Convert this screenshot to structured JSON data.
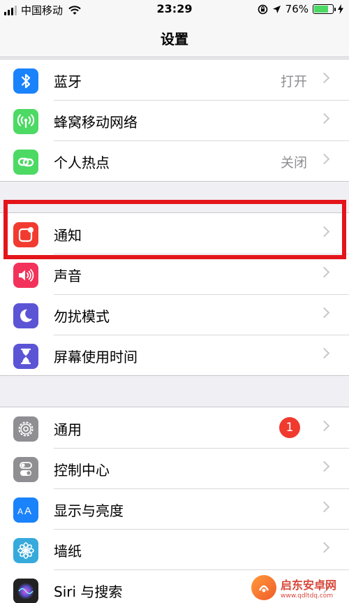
{
  "status_bar": {
    "carrier": "中国移动",
    "time": "23:29",
    "battery_percent": "76%",
    "battery_level": 0.76
  },
  "nav": {
    "title": "设置"
  },
  "groups": [
    {
      "items": [
        {
          "label": "蓝牙",
          "value": "打开",
          "icon": "bluetooth-icon",
          "color": "#1a82fb"
        },
        {
          "label": "蜂窝移动网络",
          "value": "",
          "icon": "cellular-icon",
          "color": "#4cd964"
        },
        {
          "label": "个人热点",
          "value": "关闭",
          "icon": "hotspot-icon",
          "color": "#4cd964"
        }
      ]
    },
    {
      "items": [
        {
          "label": "通知",
          "value": "",
          "icon": "notifications-icon",
          "color": "#f23b30"
        },
        {
          "label": "声音",
          "value": "",
          "icon": "sound-icon",
          "color": "#f2325a"
        },
        {
          "label": "勿扰模式",
          "value": "",
          "icon": "moon-icon",
          "color": "#5b55d6"
        },
        {
          "label": "屏幕使用时间",
          "value": "",
          "icon": "hourglass-icon",
          "color": "#5b55d6"
        }
      ]
    },
    {
      "items": [
        {
          "label": "通用",
          "value": "",
          "badge": "1",
          "icon": "gear-icon",
          "color": "#8e8e93"
        },
        {
          "label": "控制中心",
          "value": "",
          "icon": "toggles-icon",
          "color": "#8e8e93"
        },
        {
          "label": "显示与亮度",
          "value": "",
          "icon": "display-icon",
          "color": "#1a82fb"
        },
        {
          "label": "墙纸",
          "value": "",
          "icon": "wallpaper-icon",
          "color": "#37aadc"
        },
        {
          "label": "Siri 与搜索",
          "value": "",
          "icon": "siri-icon",
          "color": "#222222"
        }
      ]
    }
  ],
  "watermark": {
    "title": "启东安卓网",
    "url": "www.qdltdq.com"
  }
}
